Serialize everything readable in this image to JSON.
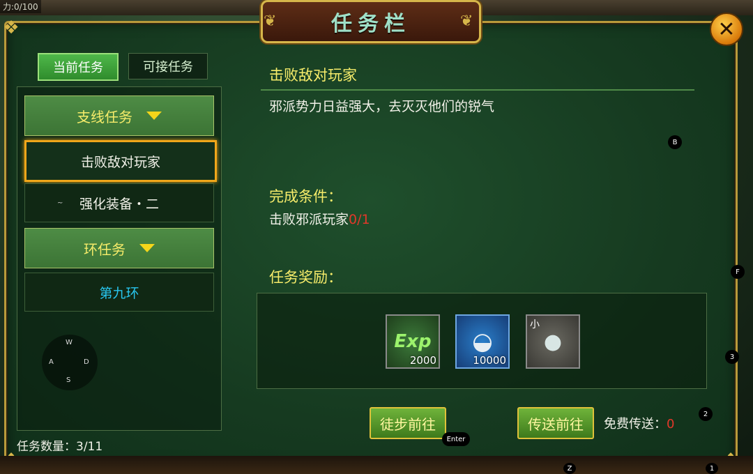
{
  "background": {
    "hp_text": "力:0/100"
  },
  "window": {
    "title": "任务栏"
  },
  "tabs": [
    {
      "label": "当前任务",
      "active": true
    },
    {
      "label": "可接任务",
      "active": false
    }
  ],
  "categories": [
    {
      "label": "支线任务"
    },
    {
      "label": "环任务"
    }
  ],
  "quest_items": [
    {
      "label": "击败敌对玩家",
      "selected": true
    },
    {
      "label": "强化装备・二"
    },
    {
      "label": "第九环"
    }
  ],
  "wasd": {
    "w": "W",
    "a": "A",
    "s": "S",
    "d": "D"
  },
  "quest_count": {
    "label": "任务数量：",
    "value": "3/11"
  },
  "detail": {
    "title": "击败敌对玩家",
    "description": "邪派势力日益强大，去灭灭他们的锐气",
    "conditions_heading": "完成条件：",
    "condition_text": "击败邪派玩家",
    "condition_progress": "0/1",
    "rewards_heading": "任务奖励："
  },
  "rewards": [
    {
      "icon": "exp-icon",
      "label": "Exp",
      "qty": "2000"
    },
    {
      "icon": "silver-ingot-icon",
      "label": "",
      "qty": "10000"
    },
    {
      "icon": "orb-icon",
      "tag": "小",
      "qty": ""
    }
  ],
  "buttons": {
    "walk": "徒步前往",
    "teleport": "传送前往"
  },
  "free_teleport": {
    "label": "免费传送：",
    "value": "0"
  },
  "hotkeys": {
    "b": "B",
    "enter": "Enter",
    "f": "F",
    "three": "3",
    "two": "2",
    "z": "Z",
    "one": "1",
    "tilde": "~"
  },
  "colors": {
    "frame_gold": "#d6b64a",
    "accent_yellow": "#f6ec6a",
    "progress_red": "#e2382a",
    "cyan": "#28c6ef"
  }
}
